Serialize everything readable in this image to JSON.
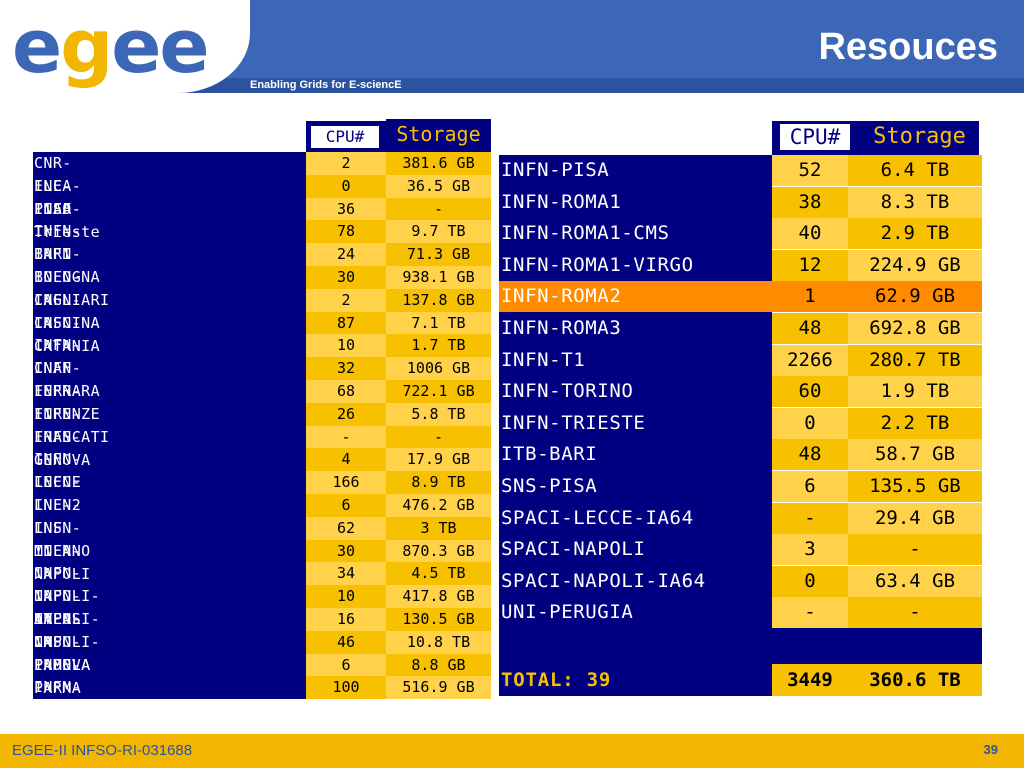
{
  "header": {
    "logo_prefix": "e",
    "logo_y": "g",
    "logo_suffix": "ee",
    "tagline": "Enabling Grids for E-sciencE",
    "title": "Resouces"
  },
  "footer": {
    "left": "EGEE-II INFSO-RI-031688",
    "page": "39"
  },
  "colors": {
    "header_blue": "#3b67b6",
    "navy": "#000080",
    "yellow_a": "#f7c000",
    "yellow_b": "#ffd24a",
    "highlight": "#ff8c00"
  },
  "table_left": {
    "headers": {
      "cpu": "CPU#",
      "storage": "Storage"
    },
    "rows": [
      {
        "name": "CNR-ILC-PISA",
        "cpu": "2",
        "storage": "381.6 GB"
      },
      {
        "name": "ENEA-INFO",
        "cpu": "0",
        "storage": "36.5 GB"
      },
      {
        "name": "INAF-Trieste",
        "cpu": "36",
        "storage": "-"
      },
      {
        "name": "INFN-BARI",
        "cpu": "78",
        "storage": "9.7 TB"
      },
      {
        "name": "INFN-BOLOGNA",
        "cpu": "24",
        "storage": "71.3 GB"
      },
      {
        "name": "INFN-CAGLIARI",
        "cpu": "30",
        "storage": "938.1 GB"
      },
      {
        "name": "INFN-CASCINA",
        "cpu": "2",
        "storage": "137.8 GB"
      },
      {
        "name": "INFN-CATANIA",
        "cpu": "87",
        "storage": "7.1 TB"
      },
      {
        "name": "INFN-CNAF",
        "cpu": "10",
        "storage": "1.7 TB"
      },
      {
        "name": "INFN-FERRARA",
        "cpu": "32",
        "storage": "1006 GB"
      },
      {
        "name": "INFN-FIRENZE",
        "cpu": "68",
        "storage": "722.1 GB"
      },
      {
        "name": "INFN-FRASCATI",
        "cpu": "26",
        "storage": "5.8 TB"
      },
      {
        "name": "INFN-GENOVA",
        "cpu": "-",
        "storage": "-"
      },
      {
        "name": "INFN-LECCE",
        "cpu": "4",
        "storage": "17.9 GB"
      },
      {
        "name": "INFN-LNL-2",
        "cpu": "166",
        "storage": "8.9 TB"
      },
      {
        "name": "INFN-LNS",
        "cpu": "6",
        "storage": "476.2 GB"
      },
      {
        "name": "INFN-MILANO",
        "cpu": "62",
        "storage": "3 TB"
      },
      {
        "name": "INFN-NAPOLI",
        "cpu": "30",
        "storage": "870.3 GB"
      },
      {
        "name": "INFN-NAPOLI-ATLAS",
        "cpu": "34",
        "storage": "4.5 TB"
      },
      {
        "name": "INFN-NAPOLI-CMS",
        "cpu": "10",
        "storage": "417.8 GB"
      },
      {
        "name": "INFN-NAPOLI-PAMELA",
        "cpu": "16",
        "storage": "130.5 GB"
      },
      {
        "name": "INFN-PADOVA",
        "cpu": "46",
        "storage": "10.8 TB"
      },
      {
        "name": "INFN-PARMA",
        "cpu": "6",
        "storage": "8.8 GB"
      },
      {
        "name": "INFN-PERUGIA",
        "cpu": "100",
        "storage": "516.9 GB"
      }
    ]
  },
  "table_right": {
    "headers": {
      "cpu": "CPU#",
      "storage": "Storage"
    },
    "rows": [
      {
        "name": "INFN-PISA",
        "cpu": "52",
        "storage": "6.4 TB"
      },
      {
        "name": "INFN-ROMA1",
        "cpu": "38",
        "storage": "8.3 TB"
      },
      {
        "name": "INFN-ROMA1-CMS",
        "cpu": "40",
        "storage": "2.9 TB"
      },
      {
        "name": "INFN-ROMA1-VIRGO",
        "cpu": "12",
        "storage": "224.9 GB"
      },
      {
        "name": "INFN-ROMA2",
        "cpu": "1",
        "storage": "62.9 GB",
        "highlight": true
      },
      {
        "name": "INFN-ROMA3",
        "cpu": "48",
        "storage": "692.8 GB"
      },
      {
        "name": "INFN-T1",
        "cpu": "2266",
        "storage": "280.7 TB"
      },
      {
        "name": "INFN-TORINO",
        "cpu": "60",
        "storage": "1.9 TB"
      },
      {
        "name": "INFN-TRIESTE",
        "cpu": "0",
        "storage": "2.2 TB"
      },
      {
        "name": "ITB-BARI",
        "cpu": "48",
        "storage": "58.7 GB"
      },
      {
        "name": "SNS-PISA",
        "cpu": "6",
        "storage": "135.5 GB"
      },
      {
        "name": "SPACI-LECCE-IA64",
        "cpu": "-",
        "storage": "29.4 GB"
      },
      {
        "name": "SPACI-NAPOLI",
        "cpu": "3",
        "storage": "-"
      },
      {
        "name": "SPACI-NAPOLI-IA64",
        "cpu": "0",
        "storage": "63.4 GB"
      },
      {
        "name": "UNI-PERUGIA",
        "cpu": "-",
        "storage": "-"
      }
    ],
    "total": {
      "label": "TOTAL: 39",
      "cpu": "3449",
      "storage": "360.6 TB"
    }
  }
}
